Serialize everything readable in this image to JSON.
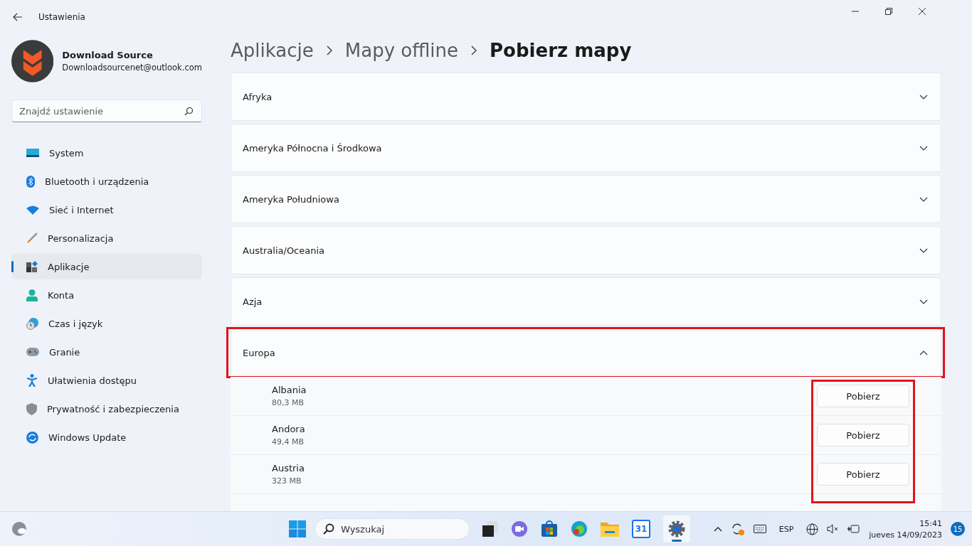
{
  "window": {
    "title": "Ustawienia"
  },
  "account": {
    "name": "Download Source",
    "email": "Downloadsourcenet@outlook.com"
  },
  "search": {
    "placeholder": "Znajdź ustawienie"
  },
  "sidebar": {
    "items": [
      {
        "label": "System",
        "kind": "system",
        "selected": false
      },
      {
        "label": "Bluetooth i urządzenia",
        "kind": "bluetooth",
        "selected": false
      },
      {
        "label": "Sieć i Internet",
        "kind": "network",
        "selected": false
      },
      {
        "label": "Personalizacja",
        "kind": "personalization",
        "selected": false
      },
      {
        "label": "Aplikacje",
        "kind": "apps",
        "selected": true
      },
      {
        "label": "Konta",
        "kind": "accounts",
        "selected": false
      },
      {
        "label": "Czas i język",
        "kind": "time",
        "selected": false
      },
      {
        "label": "Granie",
        "kind": "gaming",
        "selected": false
      },
      {
        "label": "Ułatwienia dostępu",
        "kind": "accessibility",
        "selected": false
      },
      {
        "label": "Prywatność i zabezpieczenia",
        "kind": "privacy",
        "selected": false
      },
      {
        "label": "Windows Update",
        "kind": "update",
        "selected": false
      }
    ]
  },
  "breadcrumb": [
    "Aplikacje",
    "Mapy offline",
    "Pobierz mapy"
  ],
  "regions": [
    {
      "label": "Afryka",
      "expanded": false,
      "highlighted": false
    },
    {
      "label": "Ameryka Północna i Środkowa",
      "expanded": false,
      "highlighted": false
    },
    {
      "label": "Ameryka Południowa",
      "expanded": false,
      "highlighted": false
    },
    {
      "label": "Australia/Oceania",
      "expanded": false,
      "highlighted": false
    },
    {
      "label": "Azja",
      "expanded": false,
      "highlighted": false
    },
    {
      "label": "Europa",
      "expanded": true,
      "highlighted": true,
      "buttons_highlighted": true,
      "countries": [
        {
          "name": "Albania",
          "size": "80,3 MB",
          "button": "Pobierz"
        },
        {
          "name": "Andora",
          "size": "49,4 MB",
          "button": "Pobierz"
        },
        {
          "name": "Austria",
          "size": "323 MB",
          "button": "Pobierz"
        }
      ]
    }
  ],
  "taskbar": {
    "search_placeholder": "Wyszukaj",
    "calendar_day": "31",
    "language": "ESP",
    "time": "15:41",
    "date": "jueves 14/09/2023",
    "notifications": "15"
  }
}
